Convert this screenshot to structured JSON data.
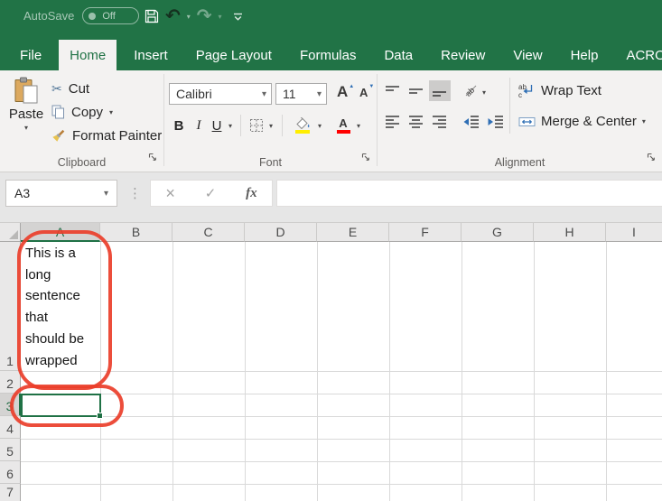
{
  "title_bar": {
    "autosave_label": "AutoSave",
    "autosave_state": "Off"
  },
  "tabs": [
    "File",
    "Home",
    "Insert",
    "Page Layout",
    "Formulas",
    "Data",
    "Review",
    "View",
    "Help",
    "ACROBAT"
  ],
  "active_tab": "Home",
  "ribbon": {
    "clipboard": {
      "group_label": "Clipboard",
      "paste_label": "Paste",
      "cut_label": "Cut",
      "copy_label": "Copy",
      "format_painter_label": "Format Painter"
    },
    "font": {
      "group_label": "Font",
      "font_name": "Calibri",
      "font_size": "11",
      "bold_label": "B",
      "italic_label": "I",
      "underline_label": "U"
    },
    "alignment": {
      "group_label": "Alignment",
      "wrap_text_label": "Wrap Text",
      "merge_center_label": "Merge & Center"
    }
  },
  "formula_bar": {
    "name_box_value": "A3",
    "fx_label": "fx",
    "formula_value": ""
  },
  "sheet": {
    "column_headers": [
      "A",
      "B",
      "C",
      "D",
      "E",
      "F",
      "G",
      "H",
      "I"
    ],
    "row_headers": [
      "1",
      "2",
      "3",
      "4",
      "5",
      "6",
      "7"
    ],
    "selected_cell": "A3",
    "cell_a1_lines": [
      "This is a",
      "long",
      "sentence",
      "that",
      "should be",
      "wrapped"
    ]
  },
  "icons": {
    "undo": "↶",
    "redo": "↷",
    "scissors": "✂",
    "vertical_dots": "⋮",
    "cancel": "×",
    "enter": "✓",
    "caret_down": "▾",
    "triangle_up": "▲",
    "triangle_down": "▼",
    "letter_a": "A",
    "orientation_letters": "ab",
    "wrap_line1": "ab",
    "wrap_line2": "c"
  },
  "colors": {
    "excel_green": "#217346",
    "annotation_red": "#ea3e2a",
    "highlight_yellow": "#ffee00",
    "font_color_red": "#ff0000"
  }
}
